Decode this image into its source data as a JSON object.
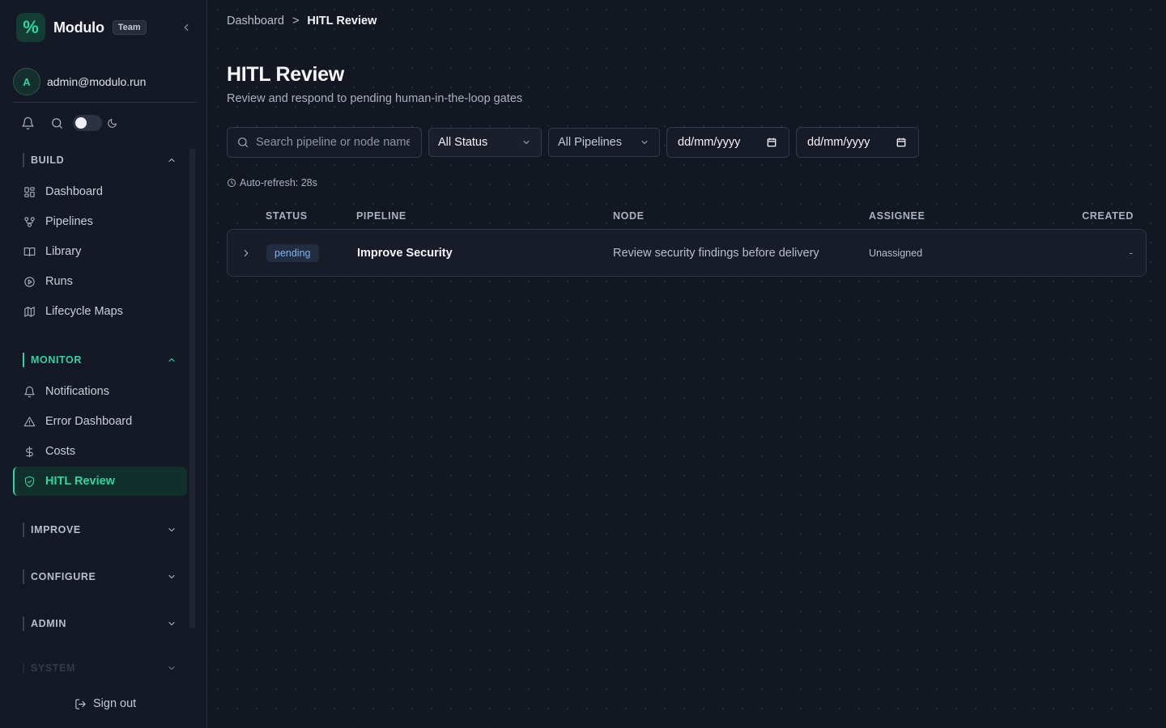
{
  "app": {
    "logo_glyph": "%",
    "name": "Modulo",
    "plan_badge": "Team"
  },
  "user": {
    "avatar_initial": "A",
    "email": "admin@modulo.run"
  },
  "sidebar": {
    "sections": [
      {
        "title": "BUILD",
        "expanded": true,
        "items": [
          {
            "label": "Dashboard",
            "icon": "grid-icon"
          },
          {
            "label": "Pipelines",
            "icon": "workflow-icon"
          },
          {
            "label": "Library",
            "icon": "book-icon"
          },
          {
            "label": "Runs",
            "icon": "play-circle-icon"
          },
          {
            "label": "Lifecycle Maps",
            "icon": "map-icon"
          }
        ]
      },
      {
        "title": "MONITOR",
        "expanded": true,
        "active": true,
        "items": [
          {
            "label": "Notifications",
            "icon": "bell-icon"
          },
          {
            "label": "Error Dashboard",
            "icon": "warning-icon"
          },
          {
            "label": "Costs",
            "icon": "dollar-icon"
          },
          {
            "label": "HITL Review",
            "icon": "shield-check-icon",
            "active": true
          }
        ]
      },
      {
        "title": "IMPROVE",
        "expanded": false
      },
      {
        "title": "CONFIGURE",
        "expanded": false
      },
      {
        "title": "ADMIN",
        "expanded": false
      },
      {
        "title": "SYSTEM",
        "expanded": false
      }
    ],
    "sign_out": "Sign out"
  },
  "breadcrumb": {
    "parent": "Dashboard",
    "separator": ">",
    "current": "HITL Review"
  },
  "page": {
    "title": "HITL Review",
    "subtitle": "Review and respond to pending human-in-the-loop gates"
  },
  "filters": {
    "search_placeholder": "Search pipeline or node name...",
    "status_value": "All Status",
    "pipeline_value": "All Pipelines",
    "date_from": "dd/mm/yyyy",
    "date_to": "dd/mm/yyyy"
  },
  "auto_refresh": "Auto-refresh: 28s",
  "table": {
    "columns": [
      "STATUS",
      "PIPELINE",
      "NODE",
      "ASSIGNEE",
      "CREATED"
    ],
    "rows": [
      {
        "status": "pending",
        "pipeline": "Improve Security",
        "node": "Review security findings before delivery",
        "assignee": "Unassigned",
        "created": "-"
      }
    ]
  },
  "colors": {
    "accent": "#2fd4a0",
    "background": "#131722",
    "sidebar": "#151925",
    "pending_pill": "#7db4f0"
  }
}
